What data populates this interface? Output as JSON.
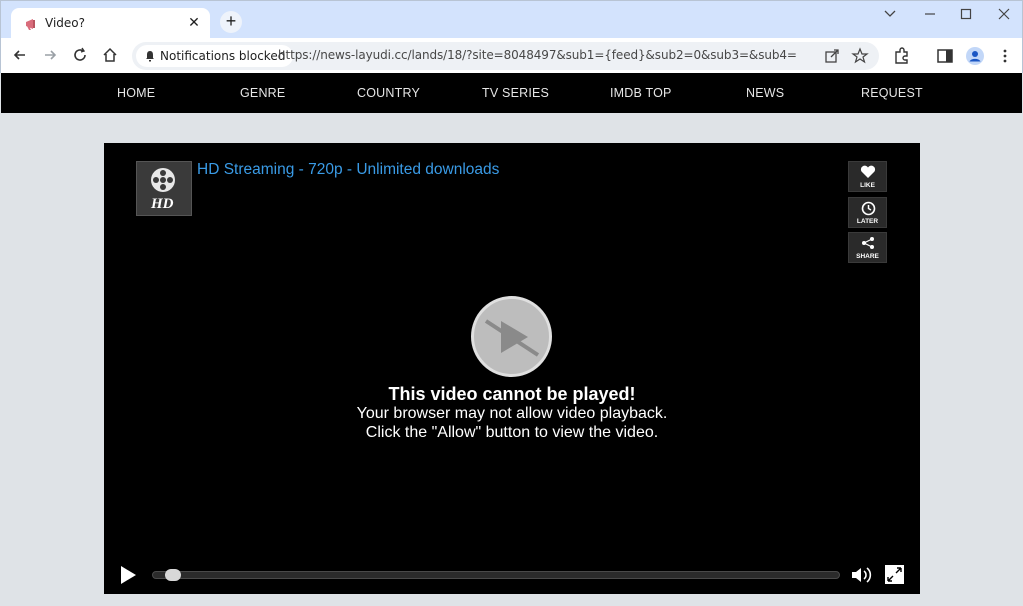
{
  "browser": {
    "tab_title": "Video?",
    "tab_close": "✕",
    "new_tab": "+",
    "notifications_chip": "Notifications blocked",
    "url": "https://news-layudi.cc/lands/18/?site=8048497&sub1={feed}&sub2=0&sub3=&sub4="
  },
  "site_nav": {
    "items": [
      "HOME",
      "GENRE",
      "COUNTRY",
      "TV SERIES",
      "IMDB TOP",
      "NEWS",
      "REQUEST"
    ]
  },
  "player": {
    "title": "HD Streaming - 720p - Unlimited downloads",
    "logo_text": "HD",
    "side_buttons": [
      "LIKE",
      "LATER",
      "SHARE"
    ],
    "message_title": "This video cannot be played!",
    "message_line1": "Your browser may not allow video playback.",
    "message_line2": "Click the \"Allow\" button to view the video."
  },
  "colors": {
    "title_blue": "#3a9be6",
    "nav_bg": "#000000",
    "tabstrip": "#d3e3fd"
  }
}
